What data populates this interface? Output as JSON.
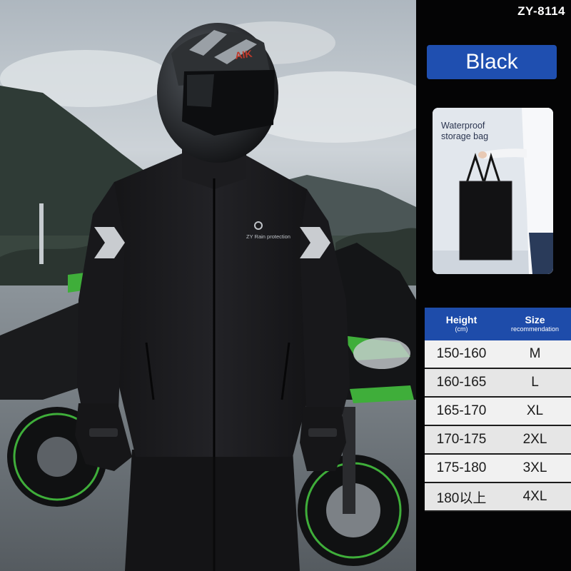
{
  "product": {
    "model": "ZY-8114",
    "color": "Black"
  },
  "bag": {
    "label": "Waterproof storage bag"
  },
  "jacket": {
    "logo_text": "ZY Rain protection"
  },
  "helmet": {
    "brand": "AIK"
  },
  "size_table": {
    "headers": [
      {
        "main": "Height",
        "sub": "(cm)"
      },
      {
        "main": "Size",
        "sub": "recommendation"
      }
    ],
    "rows": [
      {
        "height": "150-160",
        "size": "M"
      },
      {
        "height": "160-165",
        "size": "L"
      },
      {
        "height": "165-170",
        "size": "XL"
      },
      {
        "height": "170-175",
        "size": "2XL"
      },
      {
        "height": "175-180",
        "size": "3XL"
      },
      {
        "height": "180以上",
        "size": "4XL"
      }
    ]
  },
  "colors": {
    "badge_blue": "#1f4fb0",
    "table_header_blue": "#1e4caa",
    "panel_bg": "#040405",
    "accent_green": "#3fae3a"
  }
}
